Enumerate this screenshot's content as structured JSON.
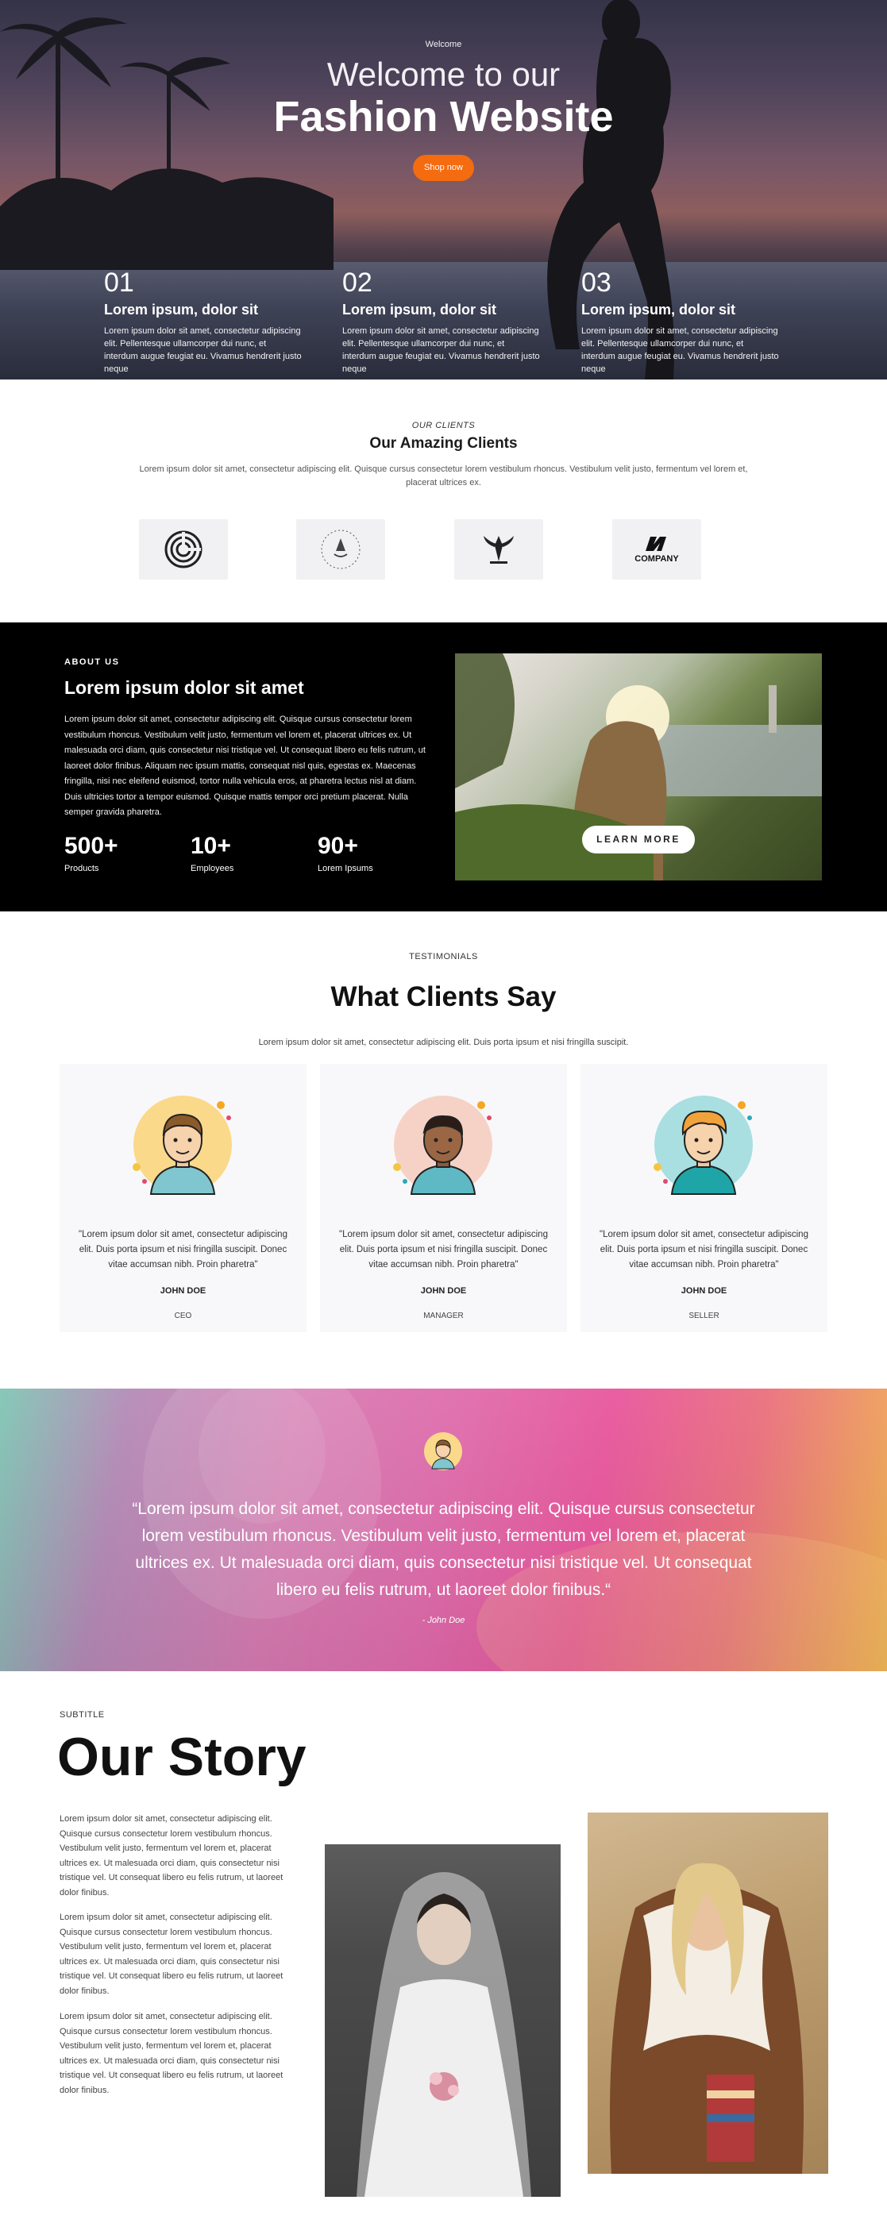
{
  "hero": {
    "kicker": "Welcome",
    "line1": "Welcome to our",
    "line2": "Fashion Website",
    "button": "Shop now",
    "steps": [
      {
        "num": "01",
        "title": "Lorem ipsum, dolor sit",
        "text": "Lorem ipsum dolor sit amet, consectetur adipiscing elit. Pellentesque ullamcorper dui nunc, et interdum augue feugiat eu. Vivamus hendrerit justo neque"
      },
      {
        "num": "02",
        "title": "Lorem ipsum, dolor sit",
        "text": "Lorem ipsum dolor sit amet, consectetur adipiscing elit. Pellentesque ullamcorper dui nunc, et interdum augue feugiat eu. Vivamus hendrerit justo neque"
      },
      {
        "num": "03",
        "title": "Lorem ipsum, dolor sit",
        "text": "Lorem ipsum dolor sit amet, consectetur adipiscing elit. Pellentesque ullamcorper dui nunc, et interdum augue feugiat eu. Vivamus hendrerit justo neque"
      }
    ]
  },
  "clients": {
    "kicker": "OUR CLIENTS",
    "title": "Our Amazing Clients",
    "text": "Lorem ipsum dolor sit amet, consectetur adipiscing elit. Quisque cursus consectetur lorem vestibulum rhoncus. Vestibulum velit justo, fermentum vel lorem et, placerat ultrices ex.",
    "logos": [
      {
        "icon": "spiral-disc-logo-icon"
      },
      {
        "icon": "circular-badge-logo-icon"
      },
      {
        "icon": "winged-crest-logo-icon"
      },
      {
        "icon": "company-logo-icon",
        "text": "COMPANY"
      }
    ]
  },
  "about": {
    "kicker": "ABOUT US",
    "title": "Lorem ipsum dolor sit amet",
    "text": "Lorem ipsum dolor sit amet, consectetur adipiscing elit. Quisque cursus consectetur lorem vestibulum rhoncus. Vestibulum velit justo, fermentum vel lorem et, placerat ultrices ex. Ut malesuada orci diam, quis consectetur nisi tristique vel. Ut consequat libero eu felis rutrum, ut laoreet dolor finibus. Aliquam nec ipsum mattis, consequat nisl quis, egestas ex. Maecenas fringilla, nisi nec eleifend euismod, tortor nulla vehicula eros, at pharetra lectus nisl at diam. Duis ultricies tortor a tempor euismod. Quisque mattis tempor orci pretium placerat. Nulla semper gravida pharetra.",
    "stats": [
      {
        "value": "500+",
        "label": "Products"
      },
      {
        "value": "10+",
        "label": "Employees"
      },
      {
        "value": "90+",
        "label": "Lorem Ipsums"
      }
    ],
    "button": "LEARN MORE"
  },
  "testimonials": {
    "kicker": "TESTIMONIALS",
    "title": "What Clients Say",
    "text": "Lorem ipsum dolor sit amet, consectetur adipiscing elit. Duis porta ipsum et nisi fringilla suscipit.",
    "cards": [
      {
        "quote": "\"Lorem ipsum dolor sit amet, consectetur adipiscing elit. Duis porta ipsum et nisi fringilla suscipit. Donec vitae accumsan nibh. Proin pharetra\"",
        "name": "JOHN DOE",
        "role": "CEO",
        "bg": "#fbd98a"
      },
      {
        "quote": "\"Lorem ipsum dolor sit amet, consectetur adipiscing elit. Duis porta ipsum et nisi fringilla suscipit. Donec vitae accumsan nibh. Proin pharetra\"",
        "name": "JOHN DOE",
        "role": "MANAGER",
        "bg": "#f6d2c6"
      },
      {
        "quote": "\"Lorem ipsum dolor sit amet, consectetur adipiscing elit. Duis porta ipsum et nisi fringilla suscipit. Donec vitae accumsan nibh. Proin pharetra\"",
        "name": "JOHN DOE",
        "role": "SELLER",
        "bg": "#a9dfe0"
      }
    ]
  },
  "banner": {
    "quote": "“Lorem ipsum dolor sit amet, consectetur adipiscing elit. Quisque cursus consectetur lorem vestibulum rhoncus. Vestibulum velit justo, fermentum vel lorem et, placerat ultrices ex. Ut malesuada orci diam, quis consectetur nisi tristique vel. Ut consequat libero eu felis rutrum, ut laoreet dolor finibus.“",
    "author": "- John Doe"
  },
  "story": {
    "kicker": "SUBTITLE",
    "title": "Our Story",
    "paragraphs": [
      "Lorem ipsum dolor sit amet, consectetur adipiscing elit. Quisque cursus consectetur lorem vestibulum rhoncus. Vestibulum velit justo, fermentum vel lorem et, placerat ultrices ex. Ut malesuada orci diam, quis consectetur nisi tristique vel. Ut consequat libero eu felis rutrum, ut laoreet dolor finibus.",
      "Lorem ipsum dolor sit amet, consectetur adipiscing elit. Quisque cursus consectetur lorem vestibulum rhoncus. Vestibulum velit justo, fermentum vel lorem et, placerat ultrices ex. Ut malesuada orci diam, quis consectetur nisi tristique vel. Ut consequat libero eu felis rutrum, ut laoreet dolor finibus.",
      "Lorem ipsum dolor sit amet, consectetur adipiscing elit. Quisque cursus consectetur lorem vestibulum rhoncus. Vestibulum velit justo, fermentum vel lorem et, placerat ultrices ex. Ut malesuada orci diam, quis consectetur nisi tristique vel. Ut consequat libero eu felis rutrum, ut laoreet dolor finibus."
    ]
  },
  "colors": {
    "accent": "#f46b10",
    "about_bg": "#000000",
    "card_bg": "#f8f8fa"
  }
}
